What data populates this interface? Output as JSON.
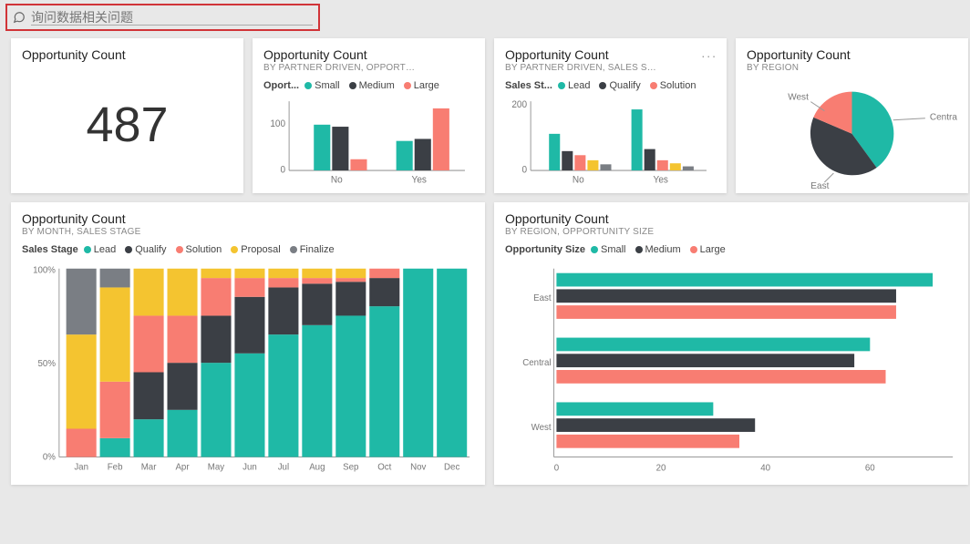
{
  "qa": {
    "placeholder": "询问数据相关问题"
  },
  "cards": {
    "kpi": {
      "title": "Opportunity Count",
      "value": "487"
    },
    "c2": {
      "title": "Opportunity Count",
      "sub": "BY PARTNER DRIVEN, OPPORT…",
      "legend_label": "Oport...",
      "l1": "Small",
      "l2": "Medium",
      "l3": "Large"
    },
    "c3": {
      "title": "Opportunity Count",
      "sub": "BY PARTNER DRIVEN, SALES S…",
      "legend_label": "Sales St...",
      "l1": "Lead",
      "l2": "Qualify",
      "l3": "Solution",
      "more": "..."
    },
    "c4": {
      "title": "Opportunity Count",
      "sub": "BY REGION",
      "l1": "West",
      "l2": "Central",
      "l3": "East"
    },
    "c5": {
      "title": "Opportunity Count",
      "sub": "BY MONTH, SALES STAGE",
      "legend_label": "Sales Stage",
      "l1": "Lead",
      "l2": "Qualify",
      "l3": "Solution",
      "l4": "Proposal",
      "l5": "Finalize"
    },
    "c6": {
      "title": "Opportunity Count",
      "sub": "BY REGION, OPPORTUNITY SIZE",
      "legend_label": "Opportunity Size",
      "l1": "Small",
      "l2": "Medium",
      "l3": "Large"
    }
  },
  "colors": {
    "teal": "#1fb9a6",
    "dark": "#3b3f45",
    "coral": "#f87d72",
    "yellow": "#f4c430",
    "grey": "#7a7e84"
  },
  "chart_data": [
    {
      "id": "card2",
      "type": "bar",
      "title": "Opportunity Count",
      "subtitle": "By Partner Driven, Opportunity Size",
      "categories": [
        "No",
        "Yes"
      ],
      "series": [
        {
          "name": "Small",
          "values": [
            100,
            65
          ]
        },
        {
          "name": "Medium",
          "values": [
            95,
            70
          ]
        },
        {
          "name": "Large",
          "values": [
            25,
            135
          ]
        }
      ],
      "ylim": [
        0,
        150
      ],
      "yticks": [
        0,
        100
      ]
    },
    {
      "id": "card3",
      "type": "bar",
      "title": "Opportunity Count",
      "subtitle": "By Partner Driven, Sales Stage",
      "categories": [
        "No",
        "Yes"
      ],
      "series": [
        {
          "name": "Lead",
          "values": [
            105,
            175
          ]
        },
        {
          "name": "Qualify",
          "values": [
            55,
            60
          ]
        },
        {
          "name": "Solution",
          "values": [
            45,
            30
          ]
        }
      ],
      "extra_series": [
        {
          "values": [
            30,
            20
          ]
        },
        {
          "values": [
            18,
            12
          ]
        }
      ],
      "ylim": [
        0,
        200
      ],
      "yticks": [
        0,
        200
      ]
    },
    {
      "id": "card4",
      "type": "pie",
      "title": "Opportunity Count",
      "subtitle": "By Region",
      "slices": [
        {
          "name": "Central",
          "value": 40
        },
        {
          "name": "East",
          "value": 38
        },
        {
          "name": "West",
          "value": 22
        }
      ]
    },
    {
      "id": "card5",
      "type": "bar_stacked_100",
      "title": "Opportunity Count",
      "subtitle": "By Month, Sales Stage",
      "categories": [
        "Jan",
        "Feb",
        "Mar",
        "Apr",
        "May",
        "Jun",
        "Jul",
        "Aug",
        "Sep",
        "Oct",
        "Nov",
        "Dec"
      ],
      "series": [
        {
          "name": "Lead",
          "values": [
            0,
            10,
            20,
            25,
            50,
            55,
            65,
            70,
            75,
            80,
            100,
            100
          ]
        },
        {
          "name": "Qualify",
          "values": [
            0,
            0,
            25,
            25,
            25,
            30,
            25,
            22,
            18,
            15,
            0,
            0
          ]
        },
        {
          "name": "Solution",
          "values": [
            15,
            30,
            30,
            25,
            20,
            10,
            5,
            3,
            2,
            5,
            0,
            0
          ]
        },
        {
          "name": "Proposal",
          "values": [
            50,
            50,
            25,
            25,
            5,
            5,
            5,
            5,
            5,
            0,
            0,
            0
          ]
        },
        {
          "name": "Finalize",
          "values": [
            35,
            10,
            0,
            0,
            0,
            0,
            0,
            0,
            0,
            0,
            0,
            0
          ]
        }
      ],
      "yticks": [
        "0%",
        "50%",
        "100%"
      ]
    },
    {
      "id": "card6",
      "type": "bar_horizontal",
      "title": "Opportunity Count",
      "subtitle": "By Region, Opportunity Size",
      "categories": [
        "East",
        "Central",
        "West"
      ],
      "series": [
        {
          "name": "Small",
          "values": [
            72,
            60,
            30
          ]
        },
        {
          "name": "Medium",
          "values": [
            65,
            57,
            38
          ]
        },
        {
          "name": "Large",
          "values": [
            65,
            63,
            35
          ]
        }
      ],
      "xlim": [
        0,
        75
      ],
      "xticks": [
        0,
        20,
        40,
        60
      ]
    }
  ]
}
